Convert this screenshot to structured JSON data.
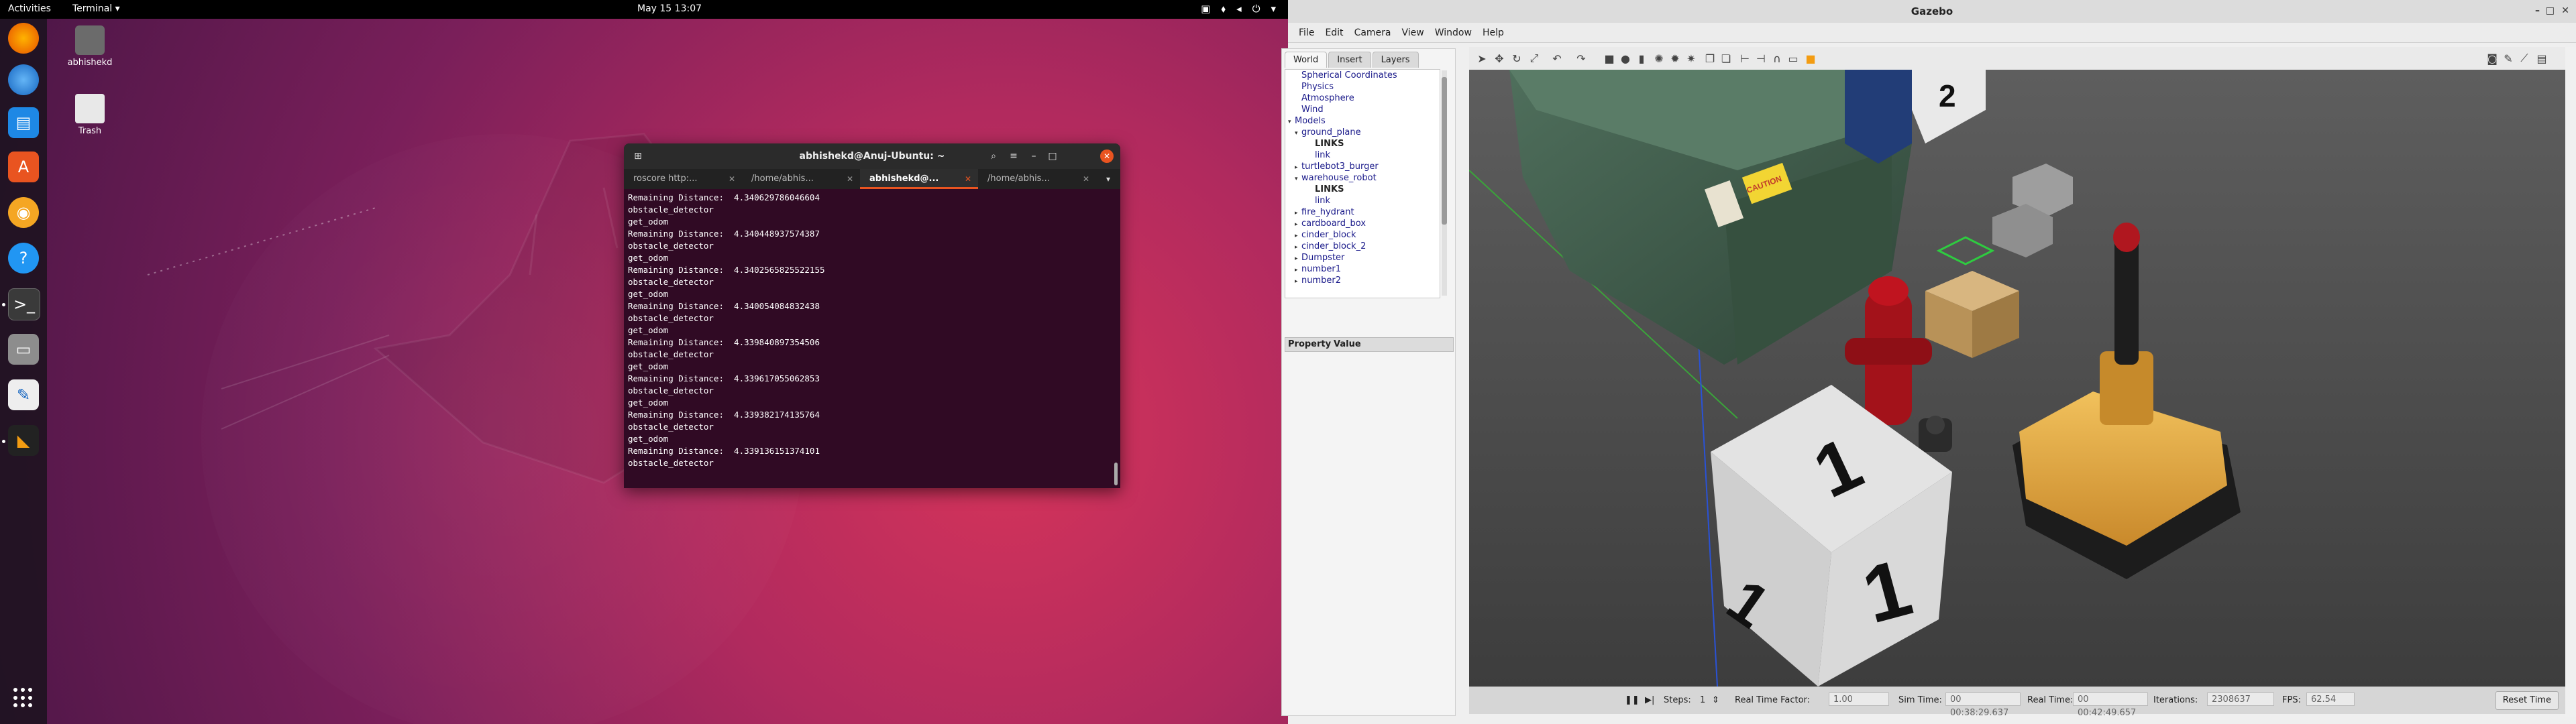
{
  "topbar": {
    "activities": "Activities",
    "app_menu": "Terminal",
    "clock": "May 15  13:07"
  },
  "desktop": {
    "icons": [
      {
        "label": "abhishekd"
      },
      {
        "label": "Trash"
      }
    ]
  },
  "dock": {
    "apps": [
      "firefox-icon",
      "thunderbird-icon",
      "writer-icon",
      "software-icon",
      "rhythmbox-icon",
      "help-icon",
      "terminal-icon",
      "files-icon",
      "text-editor-icon",
      "gazebo-icon"
    ]
  },
  "terminal": {
    "title": "abhishekd@Anuj-Ubuntu: ~",
    "tabs": [
      {
        "label": "roscore http:...",
        "active": false
      },
      {
        "label": "/home/abhis...",
        "active": false
      },
      {
        "label": "abhishekd@...",
        "active": true
      },
      {
        "label": "/home/abhis...",
        "active": false
      }
    ],
    "lines": [
      "Remaining Distance:  4.340629786046604",
      "obstacle_detector",
      "get_odom",
      "Remaining Distance:  4.340448937574387",
      "obstacle_detector",
      "get_odom",
      "Remaining Distance:  4.340256582552215​5",
      "obstacle_detector",
      "get_odom",
      "Remaining Distance:  4.340054084832438",
      "obstacle_detector",
      "get_odom",
      "Remaining Distance:  4.339840897354506",
      "obstacle_detector",
      "get_odom",
      "Remaining Distance:  4.339617055062853",
      "obstacle_detector",
      "get_odom",
      "Remaining Distance:  4.339382174135764",
      "obstacle_detector",
      "get_odom",
      "Remaining Distance:  4.339136151374101",
      "obstacle_detector"
    ]
  },
  "gazebo": {
    "title": "Gazebo",
    "menu": [
      "File",
      "Edit",
      "Camera",
      "View",
      "Window",
      "Help"
    ],
    "left_tabs": [
      "World",
      "Insert",
      "Layers"
    ],
    "tree": [
      {
        "label": "Spherical Coordinates",
        "indent": 1,
        "arrow": ""
      },
      {
        "label": "Physics",
        "indent": 1,
        "arrow": ""
      },
      {
        "label": "Atmosphere",
        "indent": 1,
        "arrow": ""
      },
      {
        "label": "Wind",
        "indent": 1,
        "arrow": ""
      },
      {
        "label": "Models",
        "indent": 0,
        "arrow": "▾"
      },
      {
        "label": "ground_plane",
        "indent": 1,
        "arrow": "▾"
      },
      {
        "label": "LINKS",
        "indent": 3,
        "arrow": "",
        "bold": true
      },
      {
        "label": "link",
        "indent": 3,
        "arrow": ""
      },
      {
        "label": "turtlebot3_burger",
        "indent": 1,
        "arrow": "▸"
      },
      {
        "label": "warehouse_robot",
        "indent": 1,
        "arrow": "▾"
      },
      {
        "label": "LINKS",
        "indent": 3,
        "arrow": "",
        "bold": true
      },
      {
        "label": "link",
        "indent": 3,
        "arrow": ""
      },
      {
        "label": "fire_hydrant",
        "indent": 1,
        "arrow": "▸"
      },
      {
        "label": "cardboard_box",
        "indent": 1,
        "arrow": "▸"
      },
      {
        "label": "cinder_block",
        "indent": 1,
        "arrow": "▸"
      },
      {
        "label": "cinder_block_2",
        "indent": 1,
        "arrow": "▸"
      },
      {
        "label": "Dumpster",
        "indent": 1,
        "arrow": "▸"
      },
      {
        "label": "number1",
        "indent": 1,
        "arrow": "▸"
      },
      {
        "label": "number2",
        "indent": 1,
        "arrow": "▸"
      }
    ],
    "property_header": {
      "property": "Property",
      "value": "Value"
    },
    "scene_labels": {
      "box_number_1": "1",
      "box_number_2": "2",
      "caution": "CAUTION"
    },
    "bottom": {
      "steps_label": "Steps:",
      "steps_value": "1",
      "rtf_label": "Real Time Factor:",
      "rtf_value": "1.00",
      "sim_time_label": "Sim Time:",
      "sim_time_value": "00 00:38:29.637",
      "real_time_label": "Real Time:",
      "real_time_value": "00 00:42:49.657",
      "iterations_label": "Iterations:",
      "iterations_value": "2308637",
      "fps_label": "FPS:",
      "fps_value": "62.54",
      "reset_label": "Reset Time"
    }
  }
}
